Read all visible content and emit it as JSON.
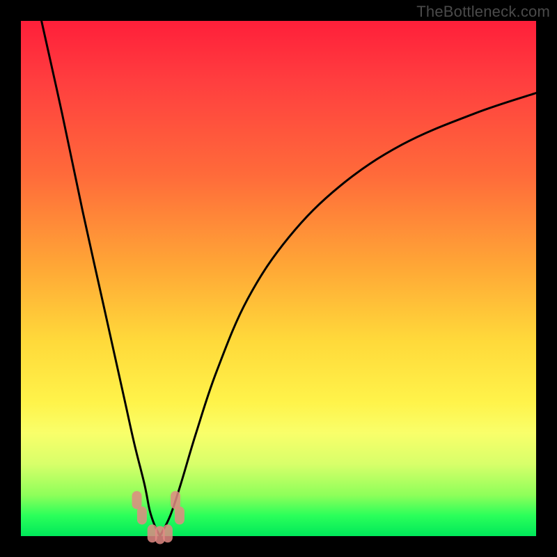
{
  "watermark": "TheBottleneck.com",
  "colors": {
    "background": "#000000",
    "curve": "#000000",
    "knot": "#e08a84",
    "gradient_top": "#ff1f3a",
    "gradient_mid": "#ffd93a",
    "gradient_bottom": "#00e85a"
  },
  "chart_data": {
    "type": "line",
    "title": "",
    "xlabel": "",
    "ylabel": "",
    "xlim": [
      0,
      100
    ],
    "ylim": [
      0,
      100
    ],
    "note": "Bottleneck-style V curve. y is %-from-bottom (0=green baseline). Minimum at x≈27 where y≈0; left branch rises steeply to top-left corner, right branch rises concavely toward top-right.",
    "series": [
      {
        "name": "left_branch",
        "x": [
          4,
          8,
          12,
          16,
          20,
          22,
          24,
          25,
          26,
          27
        ],
        "y": [
          100,
          82,
          63,
          45,
          27,
          18,
          10,
          5,
          2,
          0
        ]
      },
      {
        "name": "right_branch",
        "x": [
          27,
          29,
          31,
          34,
          38,
          44,
          52,
          62,
          74,
          88,
          100
        ],
        "y": [
          0,
          4,
          10,
          20,
          32,
          46,
          58,
          68,
          76,
          82,
          86
        ]
      }
    ],
    "markers": [
      {
        "x": 22.5,
        "y": 7,
        "group": "left"
      },
      {
        "x": 23.5,
        "y": 4,
        "group": "left"
      },
      {
        "x": 30.0,
        "y": 7,
        "group": "right"
      },
      {
        "x": 30.8,
        "y": 4,
        "group": "right"
      },
      {
        "x": 25.5,
        "y": 0.5,
        "group": "bottom"
      },
      {
        "x": 27.0,
        "y": 0.2,
        "group": "bottom"
      },
      {
        "x": 28.5,
        "y": 0.5,
        "group": "bottom"
      }
    ]
  }
}
